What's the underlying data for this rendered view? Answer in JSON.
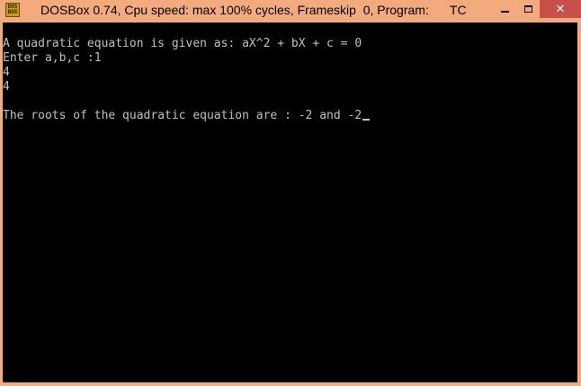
{
  "window": {
    "title": "DOSBox 0.74, Cpu speed: max 100% cycles, Frameskip  0, Program:      TC",
    "icon": "dosbox-icon",
    "icon_text_top": "DOS",
    "icon_text_bottom": "BOX",
    "controls": {
      "close_glyph": "✕"
    }
  },
  "console": {
    "lines": [
      "A quadratic equation is given as: aX^2 + bX + c = 0",
      "Enter a,b,c :1",
      "4",
      "4",
      "",
      "The roots of the quadratic equation are : -2 and -2"
    ],
    "text_color": "#c0c0c0",
    "background": "#000000"
  }
}
